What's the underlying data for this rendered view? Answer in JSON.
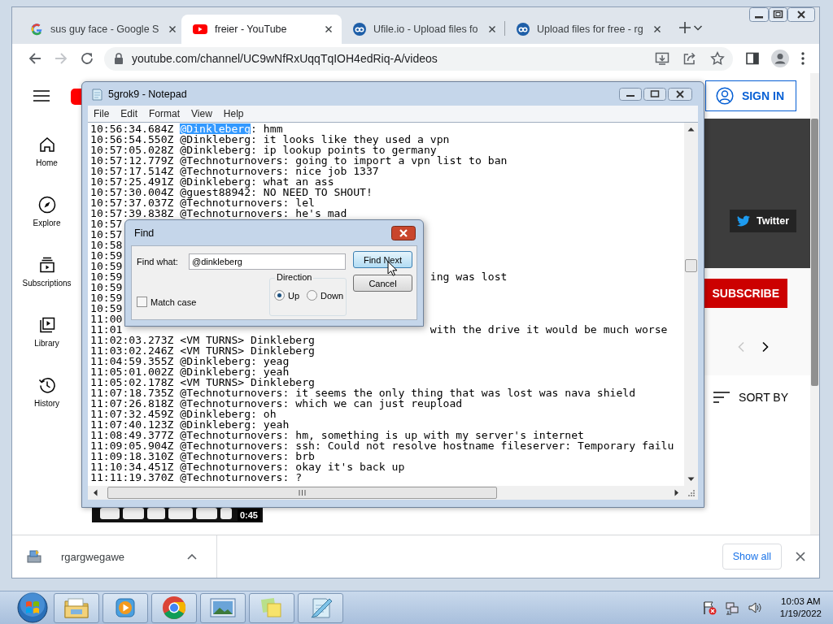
{
  "browser": {
    "tabs": [
      {
        "kind": "google",
        "title": "sus guy face - Google S",
        "selected": false
      },
      {
        "kind": "youtube",
        "title": "freier - YouTube",
        "selected": true
      },
      {
        "kind": "ufile",
        "title": "Ufile.io - Upload files fo",
        "selected": false
      },
      {
        "kind": "ufile",
        "title": "Upload files for free - rg",
        "selected": false
      }
    ],
    "forward_disabled": true,
    "address": "youtube.com/channel/UC9wNfRxUqqTqIOH4edRiq-A/videos"
  },
  "youtube": {
    "sidebar": [
      {
        "kind": "home",
        "label": "Home"
      },
      {
        "kind": "explore",
        "label": "Explore"
      },
      {
        "kind": "subscriptions",
        "label": "Subscriptions"
      },
      {
        "kind": "library",
        "label": "Library"
      },
      {
        "kind": "history",
        "label": "History"
      }
    ],
    "sign_in": "SIGN IN",
    "twitter": "Twitter",
    "subscribe": "SUBSCRIBE",
    "sort_by": "SORT BY",
    "video": {
      "kind": "picture",
      "duration": "0:45"
    }
  },
  "downloads": {
    "file": "rgargwegawe",
    "show_all": "Show all"
  },
  "notepad": {
    "title": "5grok9 - Notepad",
    "menu": [
      "File",
      "Edit",
      "Format",
      "View",
      "Help"
    ],
    "lines": [
      {
        "text": "10:56:34.684Z ",
        "selection": "@Dinkleberg",
        "after": ": hmm"
      },
      {
        "text": "10:56:54.550Z @Dinkleberg: it looks like they used a vpn"
      },
      {
        "text": "10:57:05.028Z @Dinkleberg: ip lookup points to germany"
      },
      {
        "text": "10:57:12.779Z @Technoturnovers: going to import a vpn list to ban"
      },
      {
        "text": "10:57:17.514Z @Technoturnovers: nice job 1337"
      },
      {
        "text": "10:57:25.491Z @Dinkleberg: what an ass"
      },
      {
        "text": "10:57:30.004Z @guest88942: NO NEED TO SHOUT!"
      },
      {
        "text": "10:57:37.037Z @Technoturnovers: lel"
      },
      {
        "text": "10:57:39.838Z @Technoturnovers: he's mad"
      },
      {
        "text": "10:57"
      },
      {
        "text": "10:57"
      },
      {
        "text": "10:58"
      },
      {
        "text": "10:59"
      },
      {
        "text": "10:59"
      },
      {
        "text": "10:59",
        "tail": "ing was lost"
      },
      {
        "text": "10:59"
      },
      {
        "text": "10:59"
      },
      {
        "text": "10:59"
      },
      {
        "text": "11:00"
      },
      {
        "text": "11:01",
        "tail": "with the drive it would be much worse"
      },
      {
        "text": "11:02:03.273Z <VM TURNS> Dinkleberg"
      },
      {
        "text": "11:03:02.246Z <VM TURNS> Dinkleberg"
      },
      {
        "text": "11:04:59.355Z @Dinkleberg: yeag"
      },
      {
        "text": "11:05:01.002Z @Dinkleberg: yeah"
      },
      {
        "text": "11:05:02.178Z <VM TURNS> Dinkleberg"
      },
      {
        "text": "11:07:18.735Z @Technoturnovers: it seems the only thing that was lost was nava shield"
      },
      {
        "text": "11:07:26.818Z @Technoturnovers: which we can just reupload"
      },
      {
        "text": "11:07:32.459Z @Dinkleberg: oh"
      },
      {
        "text": "11:07:40.123Z @Dinkleberg: yeah"
      },
      {
        "text": "11:08:49.377Z @Technoturnovers: hm, something is up with my server's internet"
      },
      {
        "text": "11:09:05.904Z @Technoturnovers: ssh: Could not resolve hostname fileserver: Temporary failu"
      },
      {
        "text": "11:09:18.310Z @Technoturnovers: brb"
      },
      {
        "text": "11:10:34.451Z @Technoturnovers: okay it's back up"
      },
      {
        "text": "11:11:19.370Z @Technoturnovers: ?"
      }
    ]
  },
  "find_dialog": {
    "title": "Find",
    "find_what_label": "Find what:",
    "value": "@dinkleberg",
    "buttons": [
      "Find Next",
      "Cancel"
    ],
    "direction_label": "Direction",
    "directions": [
      {
        "label": "Up",
        "selected": true
      },
      {
        "label": "Down",
        "selected": false
      }
    ],
    "match_case": {
      "label": "Match case",
      "checked": false
    }
  },
  "taskbar": {
    "apps": [
      {
        "kind": "explorer"
      },
      {
        "kind": "media_player"
      },
      {
        "kind": "chrome"
      },
      {
        "kind": "photo_viewer"
      },
      {
        "kind": "sticky_notes"
      },
      {
        "kind": "notepad"
      }
    ],
    "time": "10:03 AM",
    "date": "1/19/2022"
  }
}
